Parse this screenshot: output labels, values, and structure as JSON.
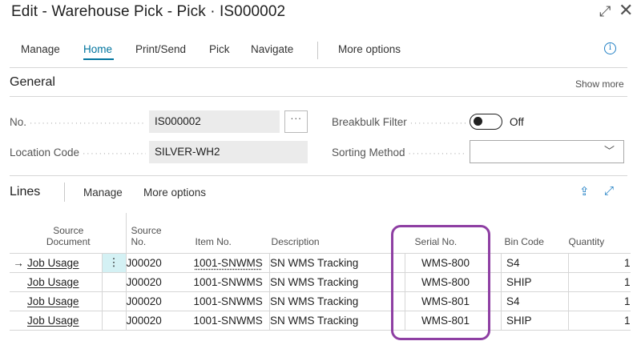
{
  "window": {
    "title": "Edit - Warehouse Pick - Pick · IS000002",
    "expand_icon": "expand-icon",
    "close_icon": "close-icon"
  },
  "actionbar": {
    "items": [
      "Manage",
      "Home",
      "Print/Send",
      "Pick",
      "Navigate",
      "More options"
    ],
    "active": "Home",
    "info_icon": "info-icon"
  },
  "general": {
    "title": "General",
    "show_more": "Show more",
    "no_label": "No.",
    "no_value": "IS000002",
    "assist_label": "···",
    "location_label": "Location Code",
    "location_value": "SILVER-WH2",
    "breakbulk_label": "Breakbulk Filter",
    "breakbulk_state": "Off",
    "sorting_label": "Sorting Method",
    "sorting_value": ""
  },
  "lines": {
    "title": "Lines",
    "actions": [
      "Manage",
      "More options"
    ],
    "icons": [
      "share-icon",
      "expand-icon"
    ],
    "columns": {
      "source_document": "Source Document",
      "source_no": "Source No.",
      "item_no": "Item No.",
      "description": "Description",
      "serial_no": "Serial No.",
      "bin_code": "Bin Code",
      "quantity": "Quantity"
    },
    "rows": [
      {
        "source_document": "Job Usage",
        "source_no": "J00020",
        "item_no": "1001-SNWMS",
        "description": "SN WMS Tracking",
        "serial_no": "WMS-800",
        "bin_code": "S4",
        "quantity": "1"
      },
      {
        "source_document": "Job Usage",
        "source_no": "J00020",
        "item_no": "1001-SNWMS",
        "description": "SN WMS Tracking",
        "serial_no": "WMS-800",
        "bin_code": "SHIP",
        "quantity": "1"
      },
      {
        "source_document": "Job Usage",
        "source_no": "J00020",
        "item_no": "1001-SNWMS",
        "description": "SN WMS Tracking",
        "serial_no": "WMS-801",
        "bin_code": "S4",
        "quantity": "1"
      },
      {
        "source_document": "Job Usage",
        "source_no": "J00020",
        "item_no": "1001-SNWMS",
        "description": "SN WMS Tracking",
        "serial_no": "WMS-801",
        "bin_code": "SHIP",
        "quantity": "1"
      }
    ]
  },
  "colors": {
    "accent": "#00749e",
    "highlight_annotation": "#8e3fa3",
    "selected_cell": "#d4f1f4"
  }
}
